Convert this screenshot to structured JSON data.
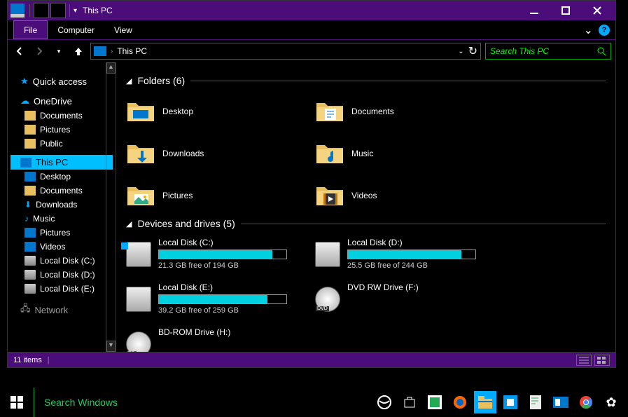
{
  "window": {
    "title": "This PC",
    "minimize": "minimize",
    "maximize": "maximize",
    "close": "close"
  },
  "ribbon": {
    "file": "File",
    "tabs": [
      "Computer",
      "View"
    ]
  },
  "address": {
    "location": "This PC",
    "search_placeholder": "Search This PC"
  },
  "sidebar": {
    "quick_access": "Quick access",
    "onedrive": "OneDrive",
    "onedrive_items": [
      "Documents",
      "Pictures",
      "Public"
    ],
    "this_pc": "This PC",
    "this_pc_items": [
      "Desktop",
      "Documents",
      "Downloads",
      "Music",
      "Pictures",
      "Videos",
      "Local Disk (C:)",
      "Local Disk (D:)",
      "Local Disk (E:)"
    ],
    "network": "Network"
  },
  "groups": {
    "folders": {
      "title": "Folders (6)",
      "items": [
        {
          "name": "Desktop",
          "icon": "desktop"
        },
        {
          "name": "Documents",
          "icon": "documents"
        },
        {
          "name": "Downloads",
          "icon": "downloads"
        },
        {
          "name": "Music",
          "icon": "music"
        },
        {
          "name": "Pictures",
          "icon": "pictures"
        },
        {
          "name": "Videos",
          "icon": "videos"
        }
      ]
    },
    "drives": {
      "title": "Devices and drives (5)",
      "items": [
        {
          "name": "Local Disk (C:)",
          "free": "21.3 GB free of 194 GB",
          "fill": 89,
          "type": "os"
        },
        {
          "name": "Local Disk (D:)",
          "free": "25.5 GB free of 244 GB",
          "fill": 89,
          "type": "hdd"
        },
        {
          "name": "Local Disk (E:)",
          "free": "39.2 GB free of 259 GB",
          "fill": 85,
          "type": "hdd"
        },
        {
          "name": "DVD RW Drive (F:)",
          "type": "dvd"
        },
        {
          "name": "BD-ROM Drive (H:)",
          "type": "bd"
        }
      ]
    }
  },
  "statusbar": {
    "count": "11 items"
  },
  "taskbar": {
    "search": "Search Windows"
  }
}
